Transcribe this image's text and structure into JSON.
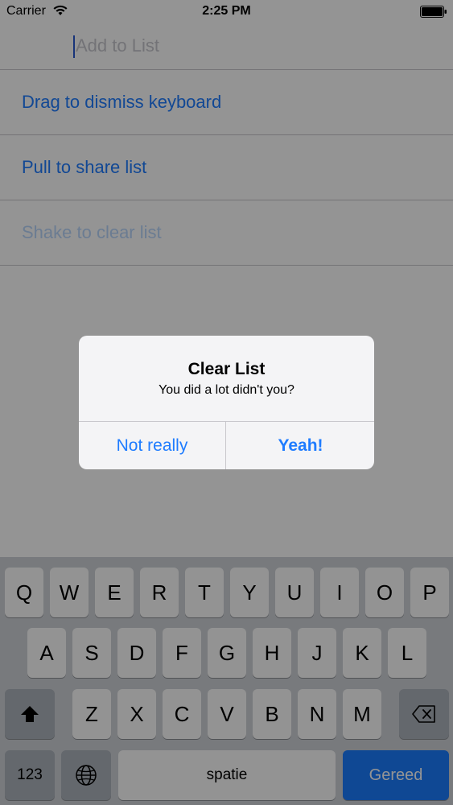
{
  "status_bar": {
    "carrier": "Carrier",
    "time": "2:25 PM"
  },
  "add_item": {
    "placeholder": "Add to List"
  },
  "list": {
    "items": [
      {
        "label": "Drag to dismiss keyboard",
        "done": false
      },
      {
        "label": "Pull to share list",
        "done": false
      },
      {
        "label": "Shake to clear list",
        "done": true
      }
    ]
  },
  "alert": {
    "title": "Clear List",
    "message": "You did a lot didn't you?",
    "cancel_label": "Not really",
    "confirm_label": "Yeah!"
  },
  "keyboard": {
    "row1": [
      "Q",
      "W",
      "E",
      "R",
      "T",
      "Y",
      "U",
      "I",
      "O",
      "P"
    ],
    "row2": [
      "A",
      "S",
      "D",
      "F",
      "G",
      "H",
      "J",
      "K",
      "L"
    ],
    "row3": [
      "Z",
      "X",
      "C",
      "V",
      "B",
      "N",
      "M"
    ],
    "numbers_label": "123",
    "space_label": "spatie",
    "return_label": "Gereed",
    "shift_icon": "shift-arrow-icon",
    "delete_icon": "backspace-icon",
    "globe_icon": "globe-icon"
  },
  "colors": {
    "accent": "#1f7cff",
    "done_text": "#b8d6fb",
    "return_key": "#1a7cff"
  }
}
